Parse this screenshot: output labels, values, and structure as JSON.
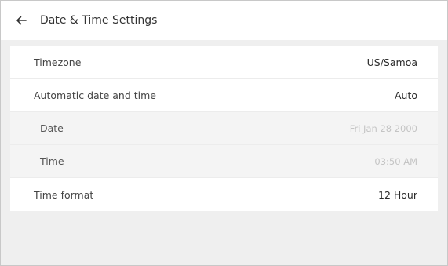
{
  "header": {
    "title": "Date & Time Settings",
    "back_icon": "arrow-left-icon"
  },
  "settings": [
    {
      "label": "Timezone",
      "value": "US/Samoa",
      "enabled": true
    },
    {
      "label": "Automatic date and time",
      "value": "Auto",
      "enabled": true
    },
    {
      "label": "Date",
      "value": "Fri Jan 28 2000",
      "enabled": false
    },
    {
      "label": "Time",
      "value": "03:50 AM",
      "enabled": false
    },
    {
      "label": "Time format",
      "value": "12 Hour",
      "enabled": true
    }
  ],
  "colors": {
    "background": "#efefef",
    "row_background": "#ffffff",
    "disabled_row_background": "#f4f4f4",
    "disabled_text": "#c4c4c4"
  }
}
